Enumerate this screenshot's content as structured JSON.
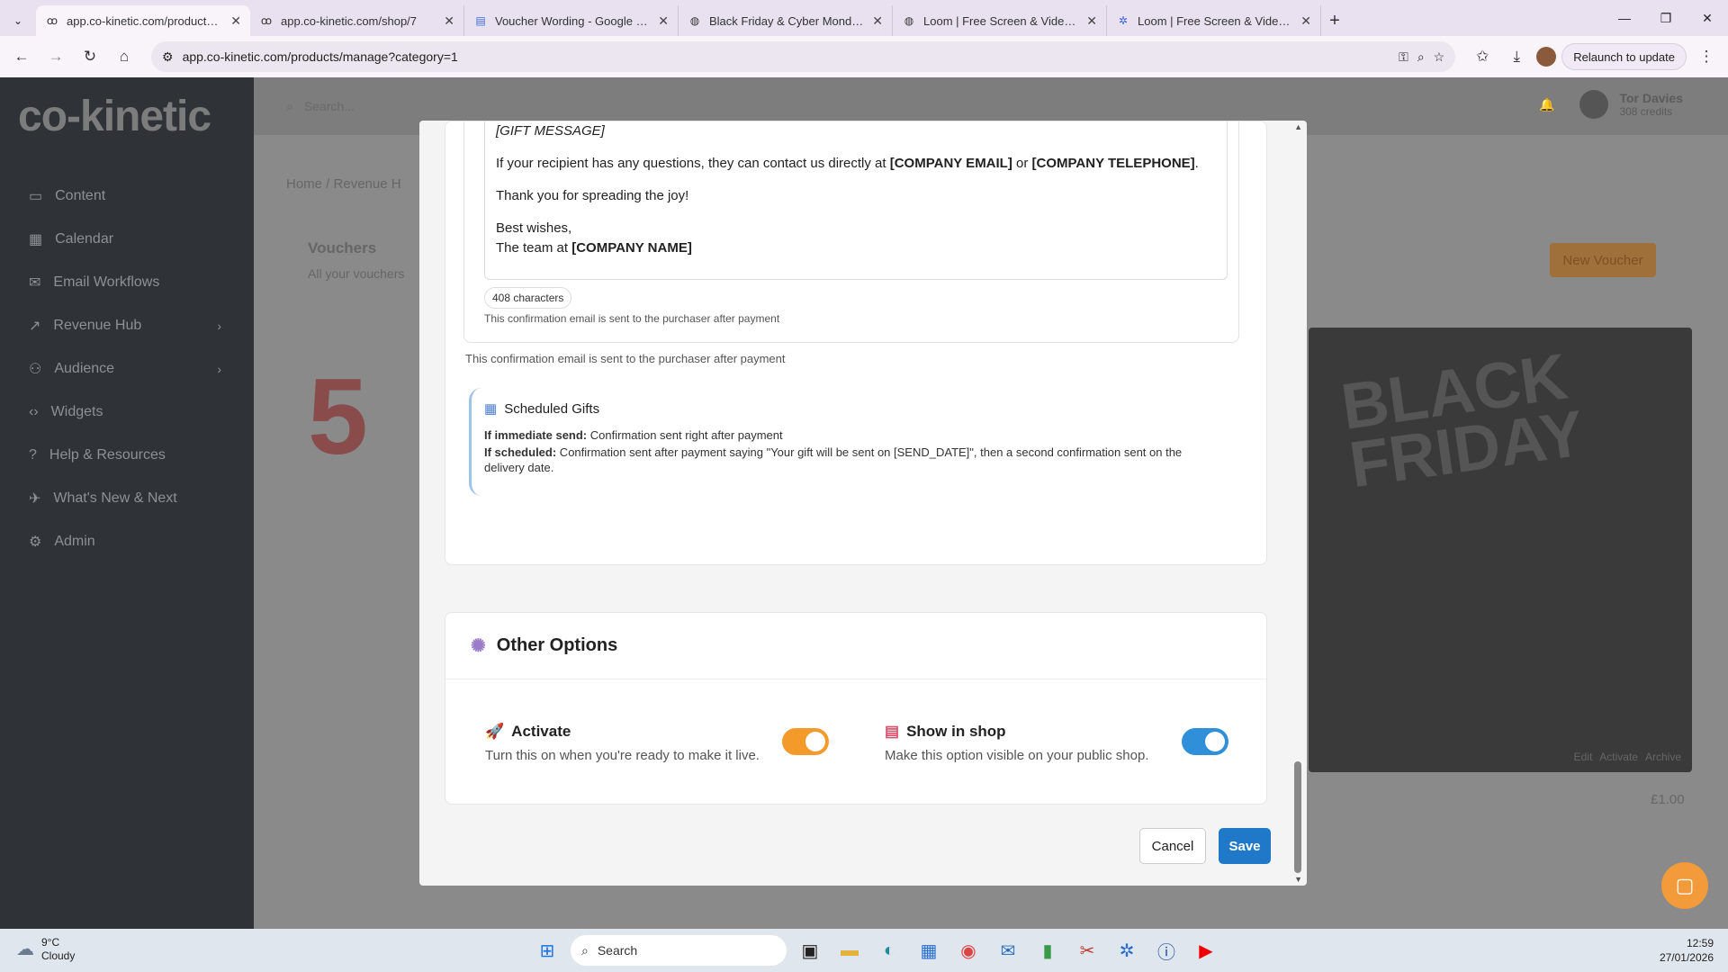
{
  "browser": {
    "tabs": [
      {
        "title": "app.co-kinetic.com/products/m",
        "active": true
      },
      {
        "title": "app.co-kinetic.com/shop/7",
        "active": false
      },
      {
        "title": "Voucher Wording - Google Doc",
        "active": false
      },
      {
        "title": "Black Friday & Cyber Monday V",
        "active": false
      },
      {
        "title": "Loom | Free Screen & Video Re",
        "active": false
      },
      {
        "title": "Loom | Free Screen & Video Re",
        "active": false
      }
    ],
    "url": "app.co-kinetic.com/products/manage?category=1",
    "relaunch": "Relaunch to update"
  },
  "app": {
    "logo": "co-kinetic",
    "search_placeholder": "Search...",
    "user": {
      "name": "Tor Davies",
      "credits": "308 credits"
    },
    "nav": [
      {
        "label": "Content",
        "icon": "document-icon",
        "chevron": false
      },
      {
        "label": "Calendar",
        "icon": "calendar-icon",
        "chevron": false
      },
      {
        "label": "Email Workflows",
        "icon": "mail-icon",
        "chevron": false
      },
      {
        "label": "Revenue Hub",
        "icon": "trend-icon",
        "chevron": true
      },
      {
        "label": "Audience",
        "icon": "users-icon",
        "chevron": true
      },
      {
        "label": "Widgets",
        "icon": "code-icon",
        "chevron": false
      },
      {
        "label": "Help & Resources",
        "icon": "help-icon",
        "chevron": false
      },
      {
        "label": "What's New & Next",
        "icon": "rocket-icon",
        "chevron": false
      },
      {
        "label": "Admin",
        "icon": "gear-icon",
        "chevron": false
      }
    ],
    "breadcrumb": [
      "Home",
      "Revenue H"
    ],
    "page_title": "Vouchers",
    "page_sub": "All your vouchers",
    "new_voucher": "New Voucher",
    "bg_card_title": "BLACK FRIDAY",
    "bg_price": "£1.00",
    "bg_actions": [
      "Edit",
      "Activate",
      "Archive"
    ]
  },
  "modal": {
    "gift_message": "[GIFT MESSAGE]",
    "para1_pre": "If your recipient has any questions, they can contact us directly at ",
    "para1_email": "[COMPANY EMAIL]",
    "para1_mid": " or ",
    "para1_phone": "[COMPANY TELEPHONE]",
    "para1_end": ".",
    "para2": "Thank you for spreading the joy!",
    "para3": "Best wishes,",
    "para4_pre": "The team at ",
    "para4_company": "[COMPANY NAME]",
    "chars": "408 characters",
    "help_inner": "This confirmation email is sent to the purchaser after payment",
    "help_outer": "This confirmation email is sent to the purchaser after payment",
    "scheduled": {
      "title": "Scheduled Gifts",
      "immediate_label": "If immediate send:",
      "immediate_text": " Confirmation sent right after payment",
      "scheduled_label": "If scheduled:",
      "scheduled_text": " Confirmation sent after payment saying \"Your gift will be sent on [SEND_DATE]\", then a second confirmation sent on the delivery date."
    },
    "other_options": {
      "title": "Other Options",
      "activate": {
        "label": "Activate",
        "desc": "Turn this on when you're ready to make it live.",
        "on": true,
        "color": "#f39a2b"
      },
      "show_in_shop": {
        "label": "Show in shop",
        "desc": "Make this option visible on your public shop.",
        "on": true,
        "color": "#2f8fd8"
      }
    },
    "cancel": "Cancel",
    "save": "Save"
  },
  "taskbar": {
    "temp": "9°C",
    "weather": "Cloudy",
    "search": "Search",
    "time": "12:59",
    "date": "27/01/2026"
  }
}
